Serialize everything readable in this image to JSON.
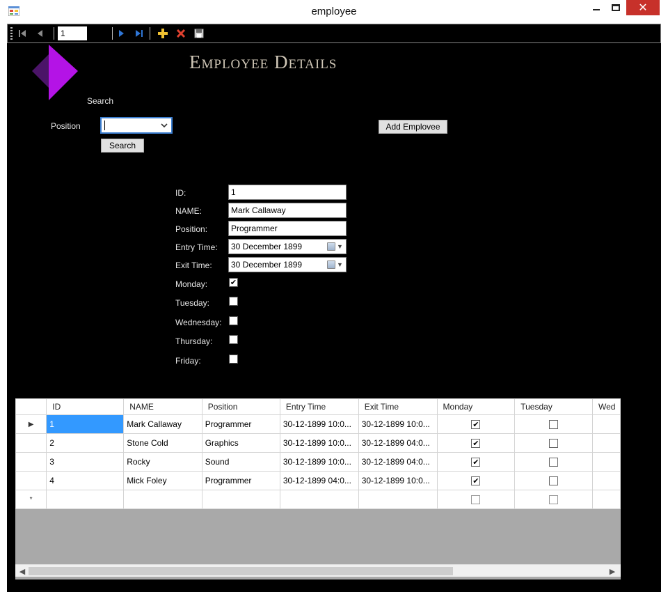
{
  "window": {
    "title": "employee",
    "close_glyph": "✕"
  },
  "toolbar": {
    "position_value": "1",
    "count_label": "",
    "icons": [
      "move-first-icon",
      "move-previous-icon",
      "move-next-icon",
      "move-last-icon",
      "add-new-icon",
      "delete-icon",
      "save-icon"
    ]
  },
  "header": {
    "title": "Employee Details",
    "logo": "purple-diamond-logo"
  },
  "search": {
    "heading": "Search",
    "position_label": "Position",
    "position_value": "",
    "search_button": "Search",
    "add_button": "Add Emplovee"
  },
  "details": {
    "id_label": "ID:",
    "id_value": "1",
    "name_label": "NAME:",
    "name_value": "Mark Callaway",
    "position_label": "Position:",
    "position_value": "Programmer",
    "entry_label": "Entry Time:",
    "entry_value": "30 December 1899",
    "exit_label": "Exit Time:",
    "exit_value": "30 December 1899",
    "days": [
      {
        "label": "Monday:",
        "checked": true
      },
      {
        "label": "Tuesday:",
        "checked": false
      },
      {
        "label": "Wednesday:",
        "checked": false
      },
      {
        "label": "Thursday:",
        "checked": false
      },
      {
        "label": "Friday:",
        "checked": false
      }
    ]
  },
  "grid": {
    "columns": [
      "ID",
      "NAME",
      "Position",
      "Entry Time",
      "Exit Time",
      "Monday",
      "Tuesday",
      "Wed"
    ],
    "rows": [
      {
        "id": "1",
        "name": "Mark Callaway",
        "position": "Programmer",
        "entry": "30-12-1899 10:0...",
        "exit": "30-12-1899 10:0...",
        "monday": true,
        "tuesday": false,
        "current": true
      },
      {
        "id": "2",
        "name": "Stone Cold",
        "position": "Graphics",
        "entry": "30-12-1899 10:0...",
        "exit": "30-12-1899 04:0...",
        "monday": true,
        "tuesday": false,
        "current": false
      },
      {
        "id": "3",
        "name": "Rocky",
        "position": "Sound",
        "entry": "30-12-1899 10:0...",
        "exit": "30-12-1899 04:0...",
        "monday": true,
        "tuesday": false,
        "current": false
      },
      {
        "id": "4",
        "name": "Mick Foley",
        "position": "Programmer",
        "entry": "30-12-1899 04:0...",
        "exit": "30-12-1899 10:0...",
        "monday": true,
        "tuesday": false,
        "current": false
      }
    ],
    "current_row_glyph": "▶",
    "new_row_glyph": "*",
    "check_glyph": "✔"
  },
  "colors": {
    "background": "#000000",
    "logo_purple": "#b413e6",
    "logo_dark": "#4b1468",
    "selection": "#3399ff",
    "close_red": "#c7312a"
  }
}
